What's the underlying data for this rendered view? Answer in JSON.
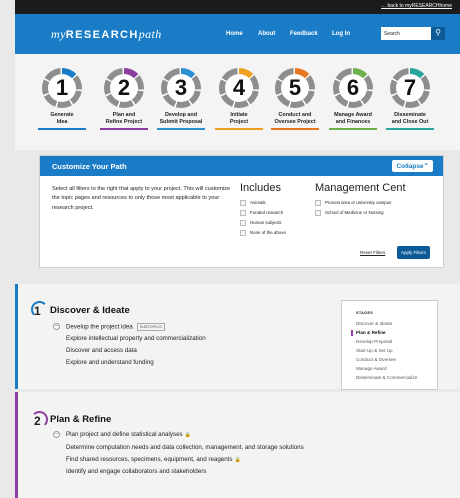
{
  "top": {
    "back_link": "← back to myRESEARCHhome"
  },
  "brand": {
    "prefix": "my",
    "middle": "RESEARCH",
    "suffix": "path"
  },
  "nav": {
    "items": [
      "Home",
      "About",
      "Feedback",
      "Log In"
    ],
    "search_placeholder": "Search",
    "search_icon": "search-icon"
  },
  "stages": [
    {
      "num": "1",
      "label": "Generate\nIdea",
      "color": "#1a7cc6"
    },
    {
      "num": "2",
      "label": "Plan and\nRefine Project",
      "color": "#8a3fa0"
    },
    {
      "num": "3",
      "label": "Develop and\nSubmit Proposal",
      "color": "#2c8fd1"
    },
    {
      "num": "4",
      "label": "Initiate\nProject",
      "color": "#f0a020"
    },
    {
      "num": "5",
      "label": "Conduct and\nOversee Project",
      "color": "#e87722"
    },
    {
      "num": "6",
      "label": "Manage Award\nand Finances",
      "color": "#6ab04c"
    },
    {
      "num": "7",
      "label": "Disseminate\nand Close Out",
      "color": "#26a69a"
    }
  ],
  "customize": {
    "title": "Customize Your Path",
    "collapse_label": "Collapse⌃",
    "description": "Select all filters to the right that apply to your project. This will customize the topic pages and resources to only those most applicable to your research project.",
    "includes_title": "Includes",
    "includes": [
      "Animals",
      "Funded research",
      "Human subjects",
      "None of the above"
    ],
    "management_title": "Management Cent",
    "management": [
      "Provost area or university campus",
      "School of Medicine or Nursing"
    ],
    "reset_label": "Reset Filters",
    "apply_label": "Apply Filters"
  },
  "section1": {
    "num": "1",
    "title": "Discover & Ideate",
    "items": [
      {
        "text": "Develop the project idea",
        "tag": "SUBTOPICS"
      },
      {
        "text": "Explore intellectual property and commercialization"
      },
      {
        "text": "Discover and access data"
      },
      {
        "text": "Explore and understand funding"
      }
    ]
  },
  "section2": {
    "num": "2",
    "title": "Plan & Refine",
    "items": [
      {
        "text": "Plan project and define statistical analyses",
        "lock": "🔒"
      },
      {
        "text": "Determine computation needs and data collection, management, and storage solutions"
      },
      {
        "text": "Find shared resources, specimens, equipment, and reagents",
        "lock": "🔒"
      },
      {
        "text": "Identify and engage collaborators and stakeholders"
      }
    ]
  },
  "stages_box": {
    "title": "STAGES",
    "items": [
      "Discover & Ideate",
      "Plan & Refine",
      "Develop Proposal",
      "Start Up & Set Up",
      "Conduct & Oversee",
      "Manage Award",
      "Disseminate & Commercialize"
    ],
    "selected": "Plan & Refine"
  }
}
